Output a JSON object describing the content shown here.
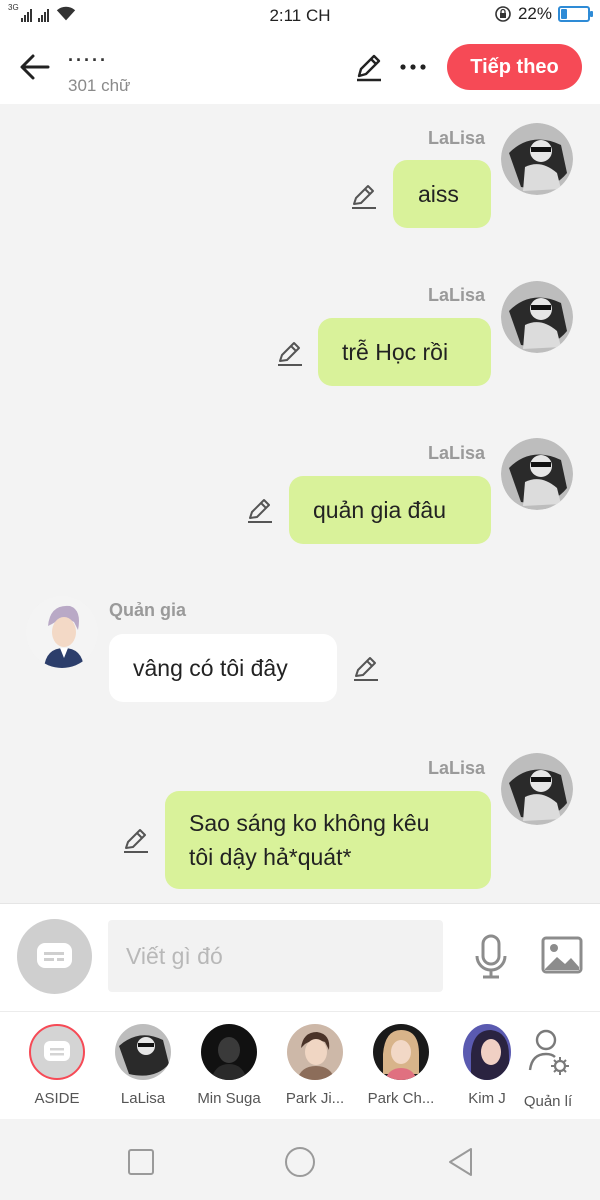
{
  "status_bar": {
    "network_label": "3G",
    "time": "2:11 CH",
    "battery_percent": "22%",
    "battery_level": 0.22
  },
  "header": {
    "title": "·····",
    "subtitle": "301 chữ",
    "next_label": "Tiếp theo",
    "icons": [
      "back-arrow-icon",
      "pencil-icon",
      "more-dots-icon"
    ]
  },
  "messages": [
    {
      "sender": "LaLisa",
      "text": "aiss",
      "side": "right"
    },
    {
      "sender": "LaLisa",
      "text": "trễ Học rồi",
      "side": "right"
    },
    {
      "sender": "LaLisa",
      "text": "quản gia đâu",
      "side": "right"
    },
    {
      "sender": "Quản gia",
      "text": "vâng có tôi đây",
      "side": "left"
    },
    {
      "sender": "LaLisa",
      "text": "Sao sáng ko không kêu",
      "text2": "tôi dậy hả*quát*",
      "side": "right"
    }
  ],
  "input": {
    "placeholder": "Viết gì đó",
    "icons": [
      "chat-bubble-icon",
      "microphone-icon",
      "image-icon"
    ]
  },
  "characters": [
    {
      "name": "ASIDE"
    },
    {
      "name": "LaLisa"
    },
    {
      "name": "Min Suga"
    },
    {
      "name": "Park Ji..."
    },
    {
      "name": "Park Ch..."
    },
    {
      "name": "Kim J"
    },
    {
      "name": "Quản lí"
    }
  ],
  "nav": {
    "icons": [
      "square-icon",
      "circle-icon",
      "triangle-back-icon"
    ]
  },
  "colors": {
    "accent_red": "#f64a56",
    "user_bubble": "#d9f29a",
    "other_bubble": "#ffffff",
    "battery": "#2e8bd6"
  }
}
